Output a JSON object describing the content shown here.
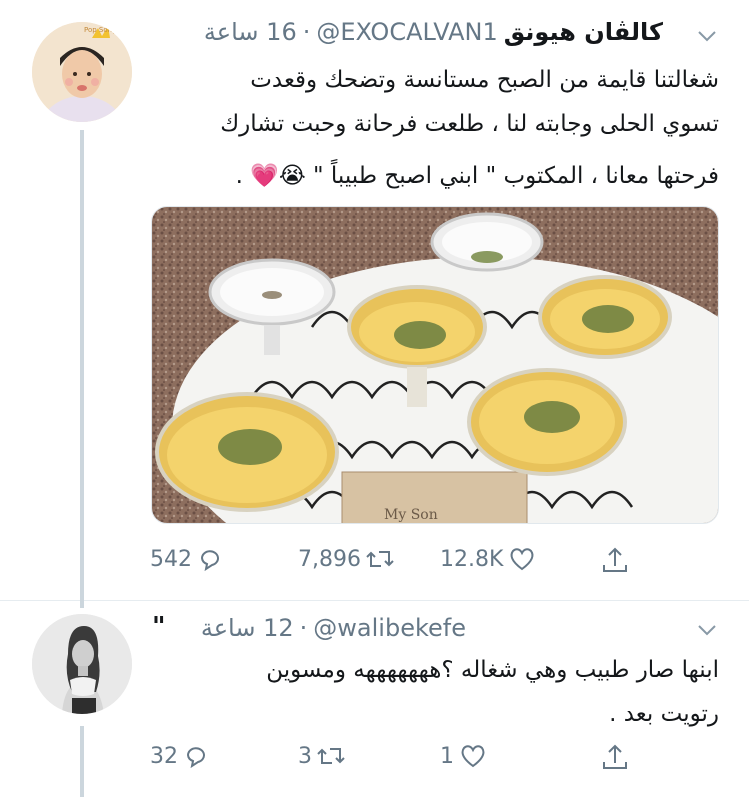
{
  "tweets": [
    {
      "name": "كالڤان هيونق",
      "handle": "@EXOCALVAN1",
      "dot": "·",
      "time": "16 ساعة",
      "lines": [
        "شغالتنا قايمة من الصبح مستانسة وتضحك وقعدت",
        "تسوي الحلى وجابته لنا ، طلعت فرحانة وحبت تشارك",
        "فرحتها معانا ، المكتوب \" ابني اصبح طبيباً \" 😭💗 ."
      ],
      "media": {
        "card_text": "My Son"
      },
      "replies": "542",
      "retweets": "7,896",
      "likes": "12.8K"
    },
    {
      "name": "\"",
      "handle": "@walibekefe",
      "dot": "·",
      "time": "12 ساعة",
      "lines": [
        "ابنها صار طبيب وهي شغاله ؟هههههههه ومسوين",
        "رتويت بعد ."
      ],
      "replies": "32",
      "retweets": "3",
      "likes": "1"
    }
  ]
}
